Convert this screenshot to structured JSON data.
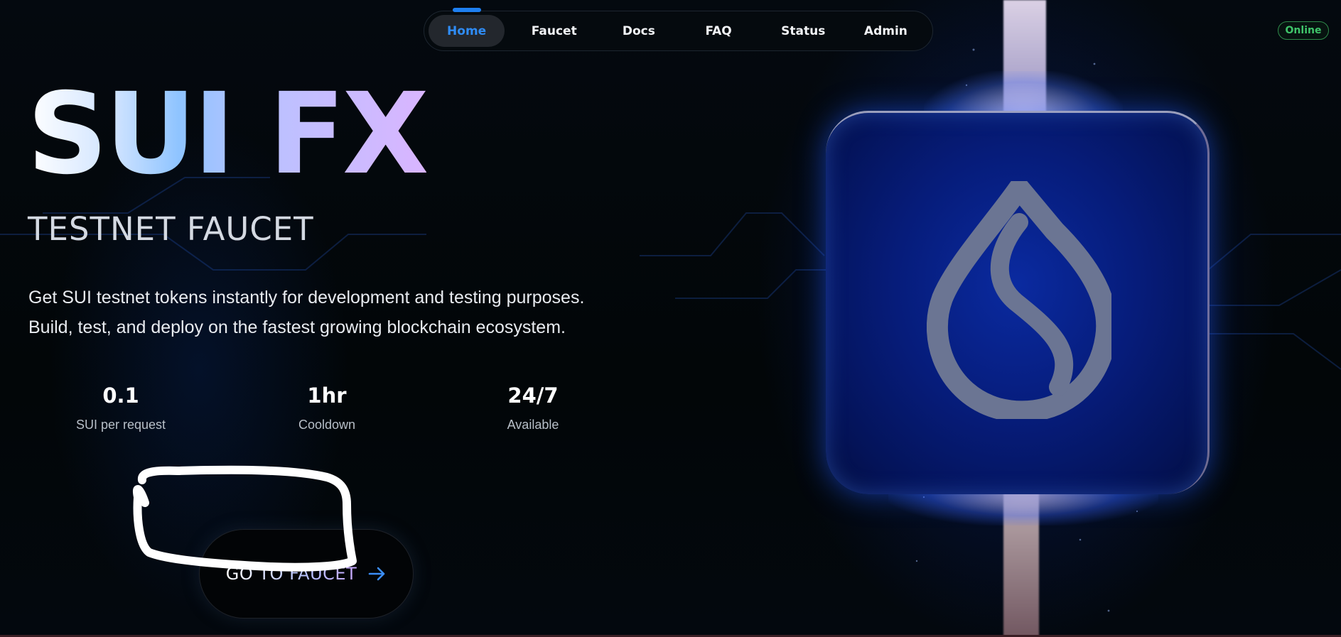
{
  "nav": {
    "items": [
      {
        "label": "Home",
        "active": true
      },
      {
        "label": "Faucet",
        "active": false
      },
      {
        "label": "Docs",
        "active": false
      },
      {
        "label": "FAQ",
        "active": false
      },
      {
        "label": "Status",
        "active": false
      },
      {
        "label": "Admin",
        "active": false
      }
    ]
  },
  "status_badge": {
    "label": "Online",
    "color": "#3fc46a"
  },
  "hero": {
    "title": "SUI FX",
    "subtitle": "TESTNET FAUCET",
    "description_line1": "Get SUI testnet tokens instantly for development and testing purposes.",
    "description_line2": "Build, test, and deploy on the fastest growing blockchain ecosystem."
  },
  "stats": [
    {
      "value": "0.1",
      "label": "SUI per request"
    },
    {
      "value": "1hr",
      "label": "Cooldown"
    },
    {
      "value": "24/7",
      "label": "Available"
    }
  ],
  "cta": {
    "label": "GO TO FAUCET",
    "icon": "arrow-right-icon"
  },
  "logo": {
    "icon": "sui-droplet-icon"
  },
  "colors": {
    "accent": "#2f8cf5",
    "background": "#020608",
    "logo_tile": "#061c7a"
  }
}
